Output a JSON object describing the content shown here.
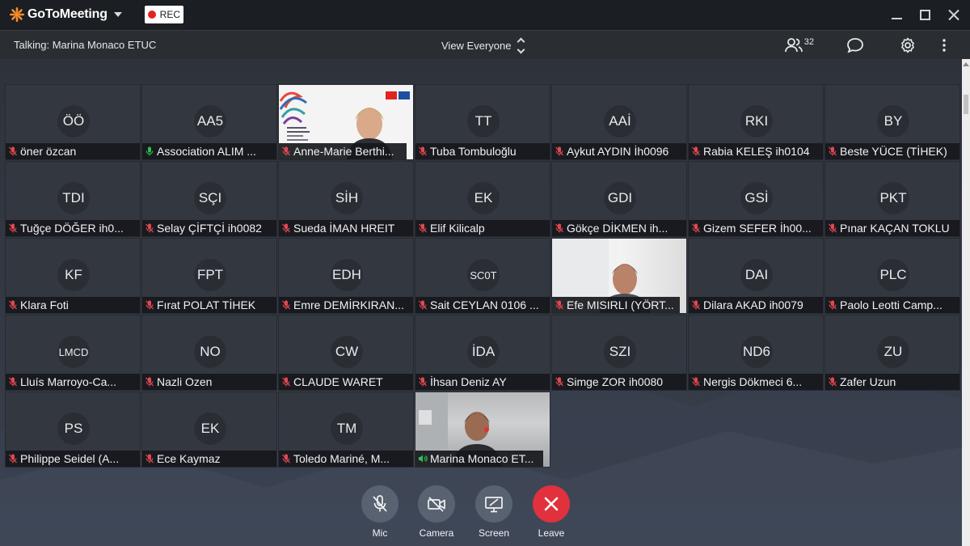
{
  "app": {
    "name": "GoToMeeting",
    "rec_label": "REC"
  },
  "infobar": {
    "talking": "Talking: Marina Monaco ETUC",
    "view_label": "View Everyone",
    "attendee_count": "32"
  },
  "tiles": [
    {
      "initials": "ÖÖ",
      "name": "öner özcan",
      "mic": "muted"
    },
    {
      "initials": "AA5",
      "name": "Association ALIM ...",
      "mic": "active"
    },
    {
      "initials": "",
      "name": "Anne-Marie Berthi...",
      "mic": "muted",
      "video": true
    },
    {
      "initials": "TT",
      "name": "Tuba Tombuloğlu",
      "mic": "muted"
    },
    {
      "initials": "AAİ",
      "name": "Aykut AYDIN İh0096",
      "mic": "muted"
    },
    {
      "initials": "RKI",
      "name": "Rabia KELEŞ ih0104",
      "mic": "muted"
    },
    {
      "initials": "BY",
      "name": "Beste YÜCE (TİHEK)",
      "mic": "muted"
    },
    {
      "initials": "TDI",
      "name": "Tuğçe DÖĞER ih0...",
      "mic": "muted"
    },
    {
      "initials": "SÇI",
      "name": "Selay ÇİFTÇİ ih0082",
      "mic": "muted"
    },
    {
      "initials": "SİH",
      "name": "Sueda İMAN HREIT",
      "mic": "muted"
    },
    {
      "initials": "EK",
      "name": "Elif Kilicalp",
      "mic": "muted"
    },
    {
      "initials": "GDI",
      "name": "Gökçe DİKMEN ih...",
      "mic": "muted"
    },
    {
      "initials": "GSİ",
      "name": "Gizem SEFER İh00...",
      "mic": "muted"
    },
    {
      "initials": "PKT",
      "name": "Pınar KAÇAN TOKLU",
      "mic": "muted"
    },
    {
      "initials": "KF",
      "name": "Klara Foti",
      "mic": "muted"
    },
    {
      "initials": "FPT",
      "name": "Fırat POLAT TİHEK",
      "mic": "muted"
    },
    {
      "initials": "EDH",
      "name": "Emre DEMİRKIRAN...",
      "mic": "muted"
    },
    {
      "initials": "SC0T",
      "name": "Sait CEYLAN 0106 ...",
      "mic": "muted"
    },
    {
      "initials": "",
      "name": "Efe MISIRLI (YÖRT...",
      "mic": "muted",
      "video": true
    },
    {
      "initials": "DAI",
      "name": "Dilara AKAD ih0079",
      "mic": "muted"
    },
    {
      "initials": "PLC",
      "name": "Paolo Leotti Camp...",
      "mic": "muted"
    },
    {
      "initials": "LMCD",
      "name": "Lluís Marroyo-Ca...",
      "mic": "muted"
    },
    {
      "initials": "NO",
      "name": "Nazli Ozen",
      "mic": "muted"
    },
    {
      "initials": "CW",
      "name": "CLAUDE WARET",
      "mic": "muted"
    },
    {
      "initials": "İDA",
      "name": "İhsan Deniz AY",
      "mic": "muted"
    },
    {
      "initials": "SZI",
      "name": "Simge ZOR ih0080",
      "mic": "muted"
    },
    {
      "initials": "ND6",
      "name": "Nergis Dökmeci 6...",
      "mic": "muted"
    },
    {
      "initials": "ZU",
      "name": "Zafer Uzun",
      "mic": "muted"
    },
    {
      "initials": "PS",
      "name": "Philippe Seidel (A...",
      "mic": "muted"
    },
    {
      "initials": "EK",
      "name": "Ece Kaymaz",
      "mic": "muted"
    },
    {
      "initials": "TM",
      "name": "Toledo Mariné, M...",
      "mic": "muted"
    },
    {
      "initials": "",
      "name": "Marina Monaco ET...",
      "mic": "speaking",
      "video": true
    }
  ],
  "controls": {
    "mic_label": "Mic",
    "camera_label": "Camera",
    "screen_label": "Screen",
    "leave_label": "Leave"
  },
  "colors": {
    "muted_mic": "#e2484f",
    "active_mic": "#2fbf4f",
    "leave_button": "#e0313d",
    "rec_dot": "#e2241f",
    "logo_orange": "#f68d2e"
  }
}
